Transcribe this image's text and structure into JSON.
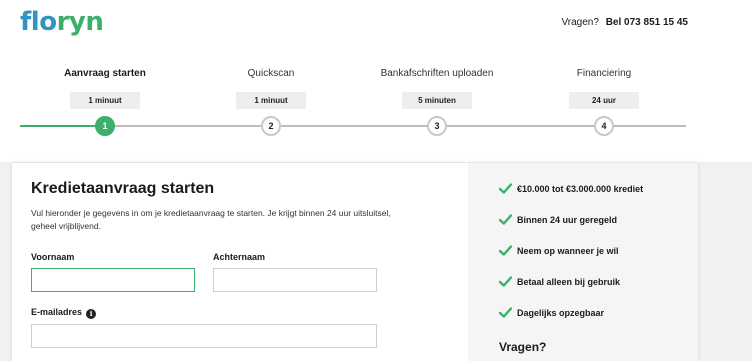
{
  "header": {
    "logo_part1": "flo",
    "logo_part2": "ryn",
    "question_label": "Vragen?",
    "phone": "Bel 073 851 15 45"
  },
  "steps": [
    {
      "number": "1",
      "title": "Aanvraag starten",
      "duration": "1 minuut",
      "active": true
    },
    {
      "number": "2",
      "title": "Quickscan",
      "duration": "1 minuut",
      "active": false
    },
    {
      "number": "3",
      "title": "Bankafschriften uploaden",
      "duration": "5 minuten",
      "active": false
    },
    {
      "number": "4",
      "title": "Financiering",
      "duration": "24 uur",
      "active": false
    }
  ],
  "form": {
    "title": "Kredietaanvraag starten",
    "intro": "Vul hieronder je gegevens in om je kredietaanvraag te starten. Je krijgt binnen 24 uur uitsluitsel, geheel vrijblijvend.",
    "first_name_label": "Voornaam",
    "first_name_value": "",
    "last_name_label": "Achternaam",
    "last_name_value": "",
    "email_label": "E-mailadres",
    "email_value": "",
    "info_icon": "i"
  },
  "sidebar": {
    "usps": [
      "€10.000 tot €3.000.000 krediet",
      "Binnen 24 uur geregeld",
      "Neem op wanneer je wil",
      "Betaal alleen bij gebruik",
      "Dagelijks opzegbaar"
    ],
    "questions_heading": "Vragen?"
  },
  "colors": {
    "brand_blue": "#2f95c3",
    "brand_green": "#3cb06a",
    "check_green": "#3cb06a"
  }
}
